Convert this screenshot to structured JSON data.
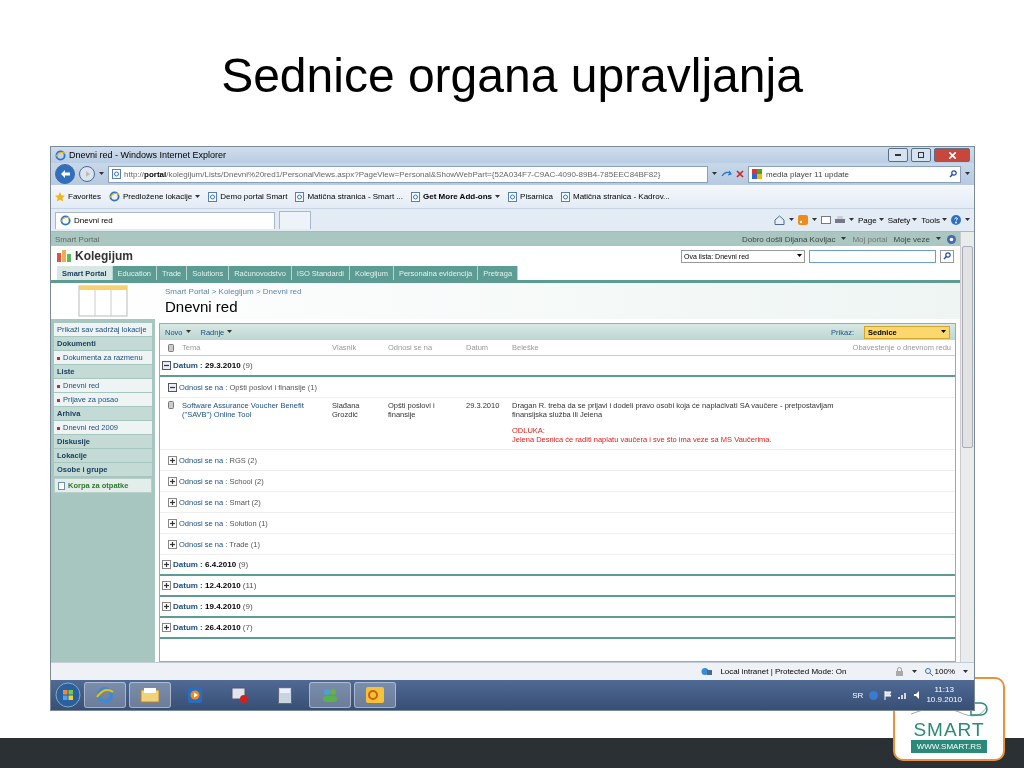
{
  "slide": {
    "title": "Sednice organa upravljanja"
  },
  "browser": {
    "title": "Dnevni red - Windows Internet Explorer",
    "address": "http://**portal**/kolegijum/Lists/Dnevni%20red1/PersonalViews.aspx?PageView=Personal&ShowWebPart={52A034F7-C9AC-4090-89B4-785EEC84BF82}",
    "search": "media player 11 update",
    "favorites": [
      {
        "kind": "favorites",
        "label": "Favorites"
      },
      {
        "kind": "menu",
        "label": "Predložene lokacije"
      },
      {
        "kind": "page",
        "label": "Demo portal Smart"
      },
      {
        "kind": "page",
        "label": "Matična stranica - Smart ..."
      },
      {
        "kind": "bold-menu",
        "label": "Get More Add-ons"
      },
      {
        "kind": "page",
        "label": "Pisarnica"
      },
      {
        "kind": "page",
        "label": "Matična stranica - Kadrov..."
      }
    ],
    "tab": "Dnevni red",
    "commands": [
      "Page",
      "Safety",
      "Tools"
    ],
    "status": "Local intranet | Protected Mode: On",
    "zoom": "100%"
  },
  "portal": {
    "site": "Smart Portal",
    "welcome": "Dobro došli Dijana Kovljac",
    "links": [
      "Moj portal",
      "Moje veze"
    ],
    "site_title": "Kolegijum",
    "search_scope": "Ova lista: Dnevni red",
    "nav": [
      {
        "label": "Smart Portal",
        "selected": true
      },
      {
        "label": "Education",
        "selected": false
      },
      {
        "label": "Trade",
        "selected": false
      },
      {
        "label": "Solutions",
        "selected": false
      },
      {
        "label": "Računovodstvo",
        "selected": false
      },
      {
        "label": "ISO Standardi",
        "selected": false
      },
      {
        "label": "Kolegijum",
        "selected": false
      },
      {
        "label": "Personalna evidencija",
        "selected": false
      },
      {
        "label": "Pretraga",
        "selected": false
      }
    ],
    "breadcrumb": "Smart Portal > Kolegijum > Dnevni red",
    "page_title": "Dnevni red",
    "quick_launch": [
      {
        "kind": "link",
        "label": "Prikaži sav sadržaj lokacije"
      },
      {
        "kind": "heading",
        "label": "Dokumenti"
      },
      {
        "kind": "item",
        "label": "Dokumenta za razmenu"
      },
      {
        "kind": "heading",
        "label": "Liste"
      },
      {
        "kind": "item",
        "label": "Dnevni red"
      },
      {
        "kind": "item",
        "label": "Prijave za posao"
      },
      {
        "kind": "heading",
        "label": "Arhiva"
      },
      {
        "kind": "item",
        "label": "Dnevni red 2009"
      },
      {
        "kind": "heading",
        "label": "Diskusije"
      },
      {
        "kind": "heading",
        "label": "Lokacije"
      },
      {
        "kind": "heading",
        "label": "Osobe i grupe"
      },
      {
        "kind": "recycle",
        "label": "Korpa za otpatke"
      }
    ],
    "toolbar": {
      "new": "Novo",
      "actions": "Radnje",
      "view_label": "Prikaz:",
      "view": "Sednice"
    },
    "columns": [
      "Tema",
      "Vlasnik",
      "Odnosi se na",
      "Datum",
      "Beleške",
      "Obavestenje o dnevnom redu"
    ],
    "groups": [
      {
        "label": "Datum :",
        "value": "29.3.2010",
        "count": "(9)",
        "expanded": true,
        "subgroups": [
          {
            "label": "Odnosi se na :",
            "value": "Opšti poslovi i finansije",
            "count": "(1)",
            "expanded": true,
            "rows": [
              {
                "tema": "Software Assurance Voucher Benefit (\"SAVB\") Online Tool",
                "vlasnik": "Slađana Grozdić",
                "odnosi": "Opšti poslovi i finansije",
                "datum": "29.3.2010",
                "beleske": "Dragan R. treba da se prijavi i dodeli pravo osobi koja će naplaćivati SA vaučere - pretpostavljam finansijska služba ili Jelena",
                "decision_label": "ODLUKA:",
                "decision": "Jelena Desnica će raditi naplatu vaučera i sve što ima veze sa MS Vaučerima."
              }
            ]
          },
          {
            "label": "Odnosi se na :",
            "value": "RGS",
            "count": "(2)",
            "expanded": false
          },
          {
            "label": "Odnosi se na :",
            "value": "School",
            "count": "(2)",
            "expanded": false
          },
          {
            "label": "Odnosi se na :",
            "value": "Smart",
            "count": "(2)",
            "expanded": false
          },
          {
            "label": "Odnosi se na :",
            "value": "Solution",
            "count": "(1)",
            "expanded": false
          },
          {
            "label": "Odnosi se na :",
            "value": "Trade",
            "count": "(1)",
            "expanded": false
          }
        ]
      },
      {
        "label": "Datum :",
        "value": "6.4.2010",
        "count": "(9)",
        "expanded": false
      },
      {
        "label": "Datum :",
        "value": "12.4.2010",
        "count": "(11)",
        "expanded": false
      },
      {
        "label": "Datum :",
        "value": "19.4.2010",
        "count": "(9)",
        "expanded": false
      },
      {
        "label": "Datum :",
        "value": "26.4.2010",
        "count": "(7)",
        "expanded": false
      }
    ]
  },
  "taskbar": {
    "language": "SR",
    "time": "11:13",
    "date": "10.9.2010"
  },
  "logo": {
    "name": "SMART",
    "url": "WWW.SMART.RS"
  }
}
